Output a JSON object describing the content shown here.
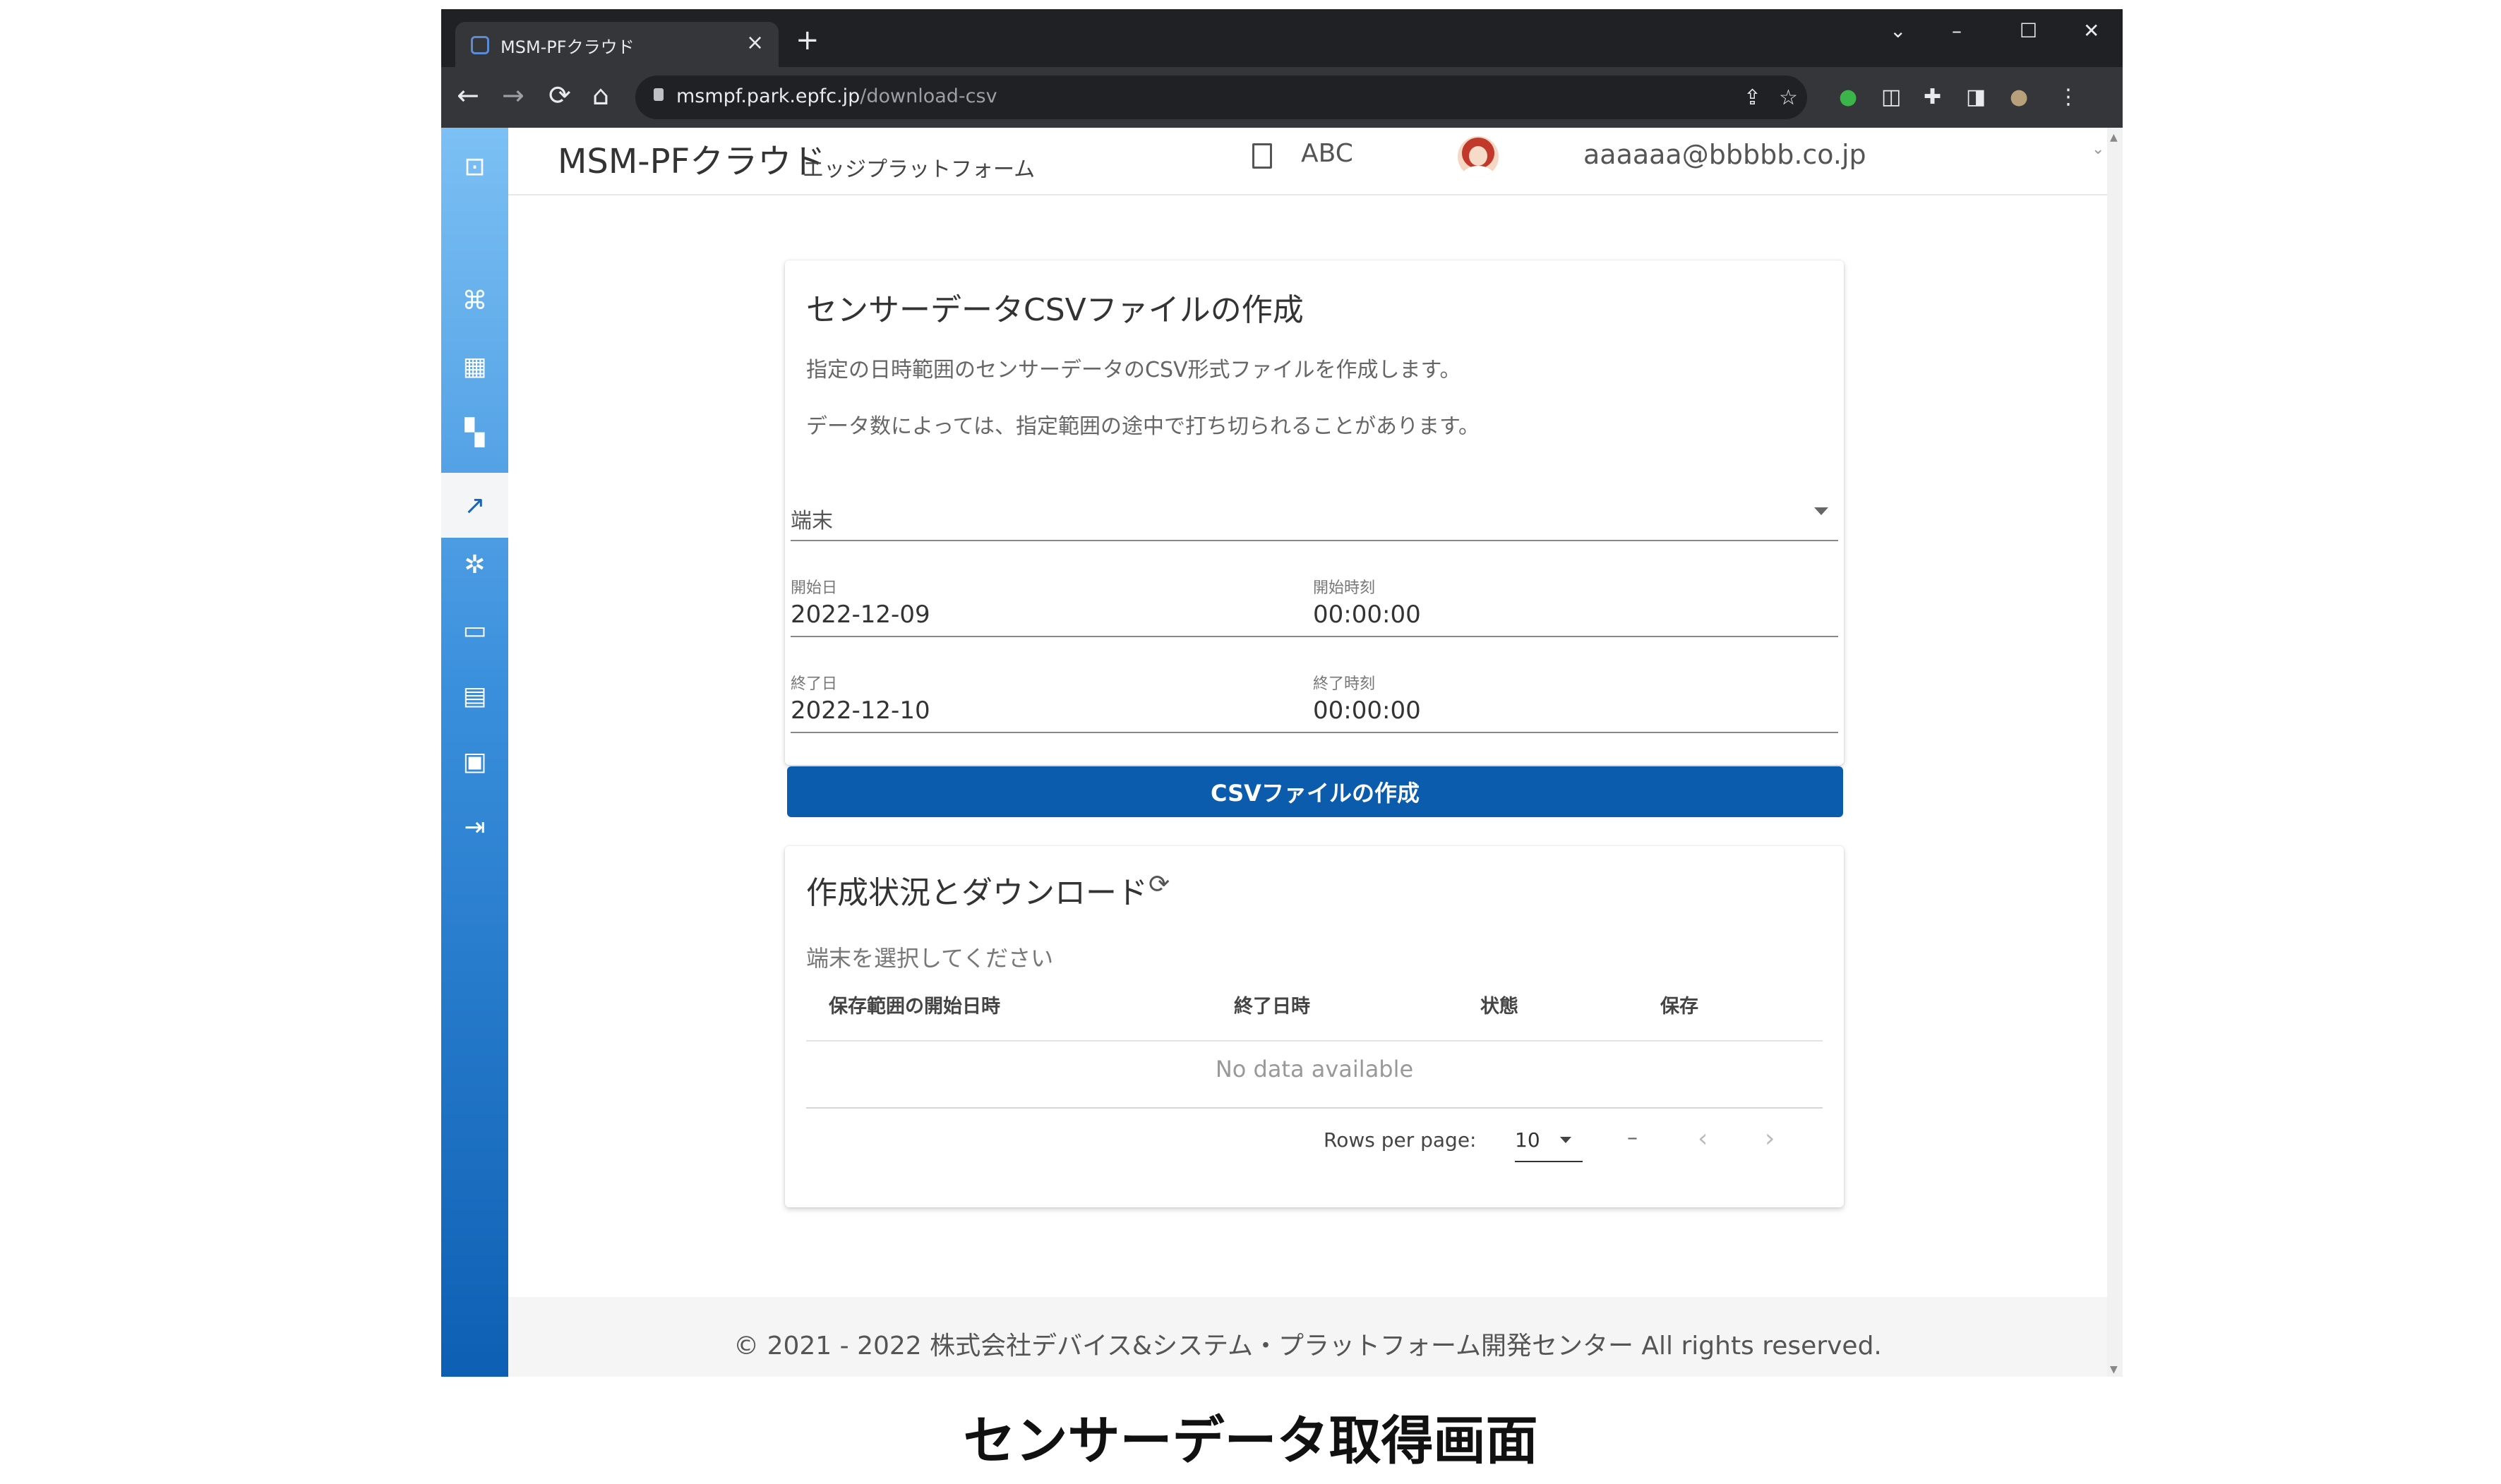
{
  "browser": {
    "tab_title": "MSM-PFクラウド",
    "tab_close": "×",
    "new_tab": "+",
    "window_controls": [
      "⌄",
      "–",
      "☐",
      "✕"
    ],
    "nav": {
      "back": "←",
      "forward": "→",
      "reload": "⟳",
      "home": "⌂"
    },
    "url_host": "msmpf.park.epfc.jp",
    "url_path": "/download-csv",
    "omnibox_icons": [
      "share-icon",
      "star-icon"
    ],
    "extension_icons": [
      "evernote-icon",
      "extension-icon",
      "puzzle-icon",
      "sidepanel-icon",
      "profile-icon",
      "kebab-menu-icon"
    ]
  },
  "app": {
    "title": "MSM-PFクラウド",
    "subtitle": "エッジプラットフォーム",
    "org": "ABC",
    "user_email": "aaaaaa@bbbbb.co.jp",
    "user_menu_chevron": "⌄",
    "sidebar": {
      "items": [
        {
          "icon": "logo-icon",
          "glyph": "⊡"
        },
        {
          "icon": "devices-icon",
          "glyph": "⌘"
        },
        {
          "icon": "apps-grid-icon",
          "glyph": "▦"
        },
        {
          "icon": "dashboard-icon",
          "glyph": "▚"
        },
        {
          "icon": "trending-icon",
          "glyph": "↗",
          "active": true
        },
        {
          "icon": "settings-icon",
          "glyph": "✲"
        },
        {
          "icon": "window-icon",
          "glyph": "▭"
        },
        {
          "icon": "file-icon",
          "glyph": "▤"
        },
        {
          "icon": "monitor-icon",
          "glyph": "▣"
        },
        {
          "icon": "logout-icon",
          "glyph": "⇥"
        }
      ]
    }
  },
  "csv_card": {
    "title": "センサーデータCSVファイルの作成",
    "desc1": "指定の日時範囲のセンサーデータのCSV形式ファイルを作成します。",
    "desc2": "データ数によっては、指定範囲の途中で打ち切られることがあります。",
    "device_label": "端末",
    "start_date_label": "開始日",
    "start_date": "2022-12-09",
    "start_time_label": "開始時刻",
    "start_time": "00:00:00",
    "end_date_label": "終了日",
    "end_date": "2022-12-10",
    "end_time_label": "終了時刻",
    "end_time": "00:00:00",
    "create_button": "CSVファイルの作成"
  },
  "status_card": {
    "title": "作成状況とダウンロード",
    "refresh_icon": "⟳",
    "hint": "端末を選択してください",
    "columns": [
      "保存範囲の開始日時",
      "終了日時",
      "状態",
      "保存"
    ],
    "no_data": "No data available",
    "rows_per_page_label": "Rows per page:",
    "rows_per_page": "10",
    "page_range": "–",
    "prev": "‹",
    "next": "›"
  },
  "footer": "© 2021 - 2022 株式会社デバイス&システム・プラットフォーム開発センター All rights reserved.",
  "caption": "センサーデータ取得画面",
  "colors": {
    "primary": "#0b5cad",
    "sidebar_top": "#7cc0f4",
    "sidebar_bottom": "#0d5fb3",
    "chrome_dark": "#202124",
    "chrome_toolbar": "#35363a"
  }
}
